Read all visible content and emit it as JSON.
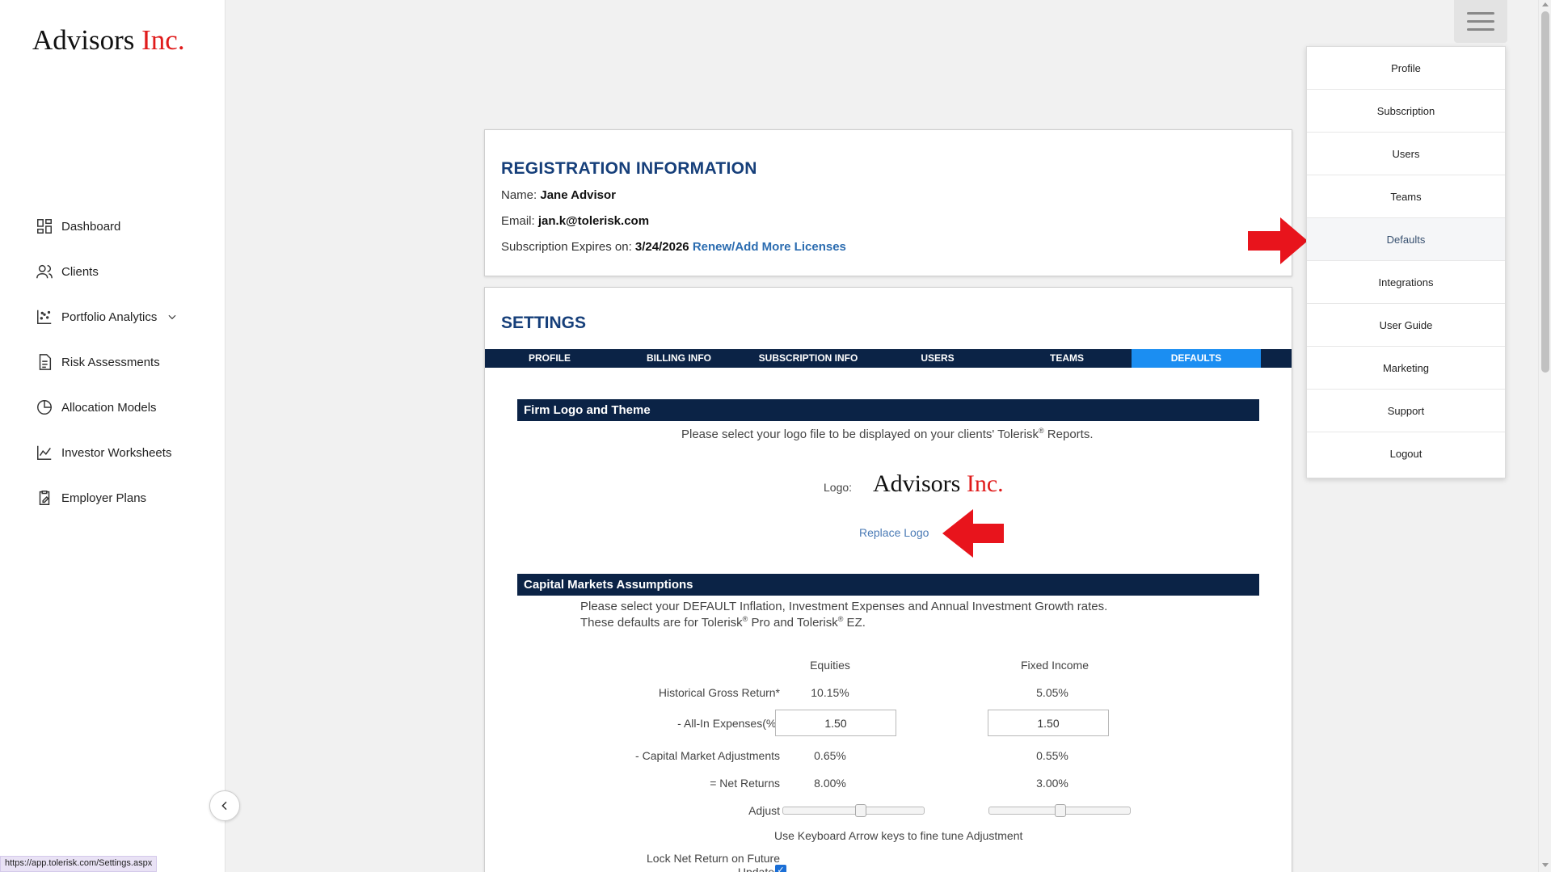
{
  "sidebar": {
    "brand": {
      "name": "Advisors",
      "suffix": "Inc."
    },
    "items": [
      {
        "label": "Dashboard",
        "icon": "dashboard-icon"
      },
      {
        "label": "Clients",
        "icon": "users-icon"
      },
      {
        "label": "Portfolio Analytics",
        "icon": "scatter-chart-icon",
        "has_chevron": true
      },
      {
        "label": "Risk Assessments",
        "icon": "document-icon"
      },
      {
        "label": "Allocation Models",
        "icon": "pie-chart-icon"
      },
      {
        "label": "Investor Worksheets",
        "icon": "line-chart-icon"
      },
      {
        "label": "Employer Plans",
        "icon": "clipboard-edit-icon"
      }
    ],
    "collapse_icon": "chevron-left-icon"
  },
  "status_url": "https://app.tolerisk.com/Settings.aspx",
  "registration": {
    "title": "REGISTRATION INFORMATION",
    "name_label": "Name:",
    "name_value": "Jane Advisor",
    "email_label": "Email:",
    "email_value": "jan.k@tolerisk.com",
    "expires_label": "Subscription Expires on:",
    "expires_value": "3/24/2026",
    "renew_link": "Renew/Add More Licenses"
  },
  "settings": {
    "title": "SETTINGS",
    "tabs": [
      "PROFILE",
      "BILLING INFO",
      "SUBSCRIPTION INFO",
      "USERS",
      "TEAMS",
      "DEFAULTS"
    ],
    "active_tab": "DEFAULTS",
    "logo_section": {
      "title": "Firm Logo and Theme",
      "note_pre": "Please select your logo file to be displayed on your clients' Tolerisk",
      "note_reg": "®",
      "note_post": " Reports.",
      "logo_label": "Logo:",
      "logo_name": "Advisors",
      "logo_suffix": "Inc.",
      "replace_link": "Replace Logo"
    },
    "cma_section": {
      "title": "Capital Markets Assumptions",
      "note_line1": "Please select your DEFAULT Inflation, Investment Expenses and Annual Investment Growth rates.",
      "note_line2_a": "These defaults are for Tolerisk",
      "note_line2_b": " Pro and Tolerisk",
      "note_line2_c": " EZ.",
      "reg": "®",
      "col_equities": "Equities",
      "col_fixed": "Fixed Income",
      "rows": {
        "historical_label": "Historical Gross Return*",
        "historical_eq": "10.15%",
        "historical_fi": "5.05%",
        "expenses_label": "- All-In Expenses(%)",
        "expenses_eq": "1.50",
        "expenses_fi": "1.50",
        "cma_label": "- Capital Market Adjustments",
        "cma_eq": "0.65%",
        "cma_fi": "0.55%",
        "net_label": "= Net Returns",
        "net_eq": "8.00%",
        "net_fi": "3.00%",
        "adjust_label": "Adjust"
      },
      "slider_eq_level": 0.55,
      "slider_fi_level": 0.5,
      "keyboard_note": "Use Keyboard Arrow keys to fine tune Adjustment",
      "lock_label": "Lock Net Return on Future Updates",
      "lock_checked": true
    }
  },
  "menu": {
    "icon": "hamburger-menu-icon",
    "items": [
      "Profile",
      "Subscription",
      "Users",
      "Teams",
      "Defaults",
      "Integrations",
      "User Guide",
      "Marketing",
      "Support",
      "Logout"
    ],
    "highlighted": "Defaults"
  },
  "colors": {
    "brand_red": "#e01b1b",
    "heading_blue": "#163f7a",
    "dark_navy": "#0b2346",
    "active_tab": "#1b8ef2",
    "link_blue": "#2b6cb0",
    "annotation_red": "#e8141c"
  }
}
